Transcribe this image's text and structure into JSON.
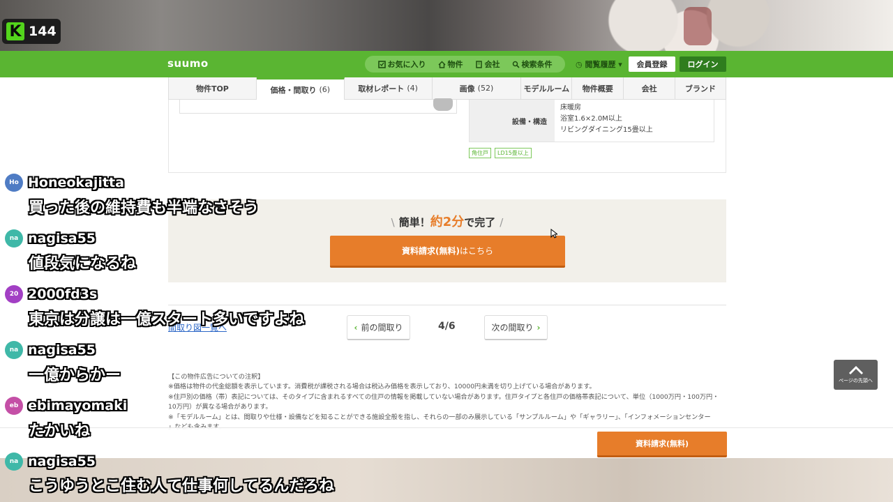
{
  "stream": {
    "badge_count": "144"
  },
  "header": {
    "logo": "suumo",
    "nav": [
      {
        "label": "お気に入り",
        "icon": "bookmark-icon"
      },
      {
        "label": "物件",
        "icon": "house-icon"
      },
      {
        "label": "会社",
        "icon": "building-icon"
      },
      {
        "label": "検索条件",
        "icon": "search-icon"
      }
    ],
    "history": "閲覧履歴",
    "register": "会員登録",
    "login": "ログイン"
  },
  "tabs": [
    {
      "label": "物件TOP",
      "count": ""
    },
    {
      "label": "価格・間取り",
      "count": "(6)"
    },
    {
      "label": "取材レポート",
      "count": "(4)"
    },
    {
      "label": "画像",
      "count": "(52)"
    },
    {
      "label": "モデルルーム",
      "count": ""
    },
    {
      "label": "物件概要",
      "count": ""
    },
    {
      "label": "会社",
      "count": ""
    },
    {
      "label": "ブランド",
      "count": ""
    }
  ],
  "spec": {
    "label": "設備・構造",
    "lines": [
      "床暖房",
      "浴室1.6×2.0M以上",
      "リビングダイニング15畳以上"
    ]
  },
  "tags": [
    "角住戸",
    "LD15畳以上"
  ],
  "cta": {
    "prefix": "簡単！",
    "highlight": "約2分",
    "suffix": "で完了",
    "button_bold": "資料請求(無料)",
    "button_rest": "はこちら"
  },
  "floorplan": {
    "list_link": "間取り図一覧へ",
    "prev": "前の間取り",
    "next": "次の間取り",
    "page": "4/6"
  },
  "notes": {
    "lines": [
      "【この物件広告についての注釈】",
      "※価格は物件の代金総額を表示しています。消費税が課税される場合は税込み価格を表示しており、10000円未満を切り上げている場合があります。",
      "※住戸別の価格（帯）表記については、そのタイプに含まれるすべての住戸の情報を掲載していない場合があります。住戸タイプと各住戸の価格帯表記について、単位（1000万円・100万円・",
      "10万円）が異なる場合があります。",
      "※「モデルルーム」とは、間取りや仕様・設備などを知ることができる施設全般を指し、それらの一部のみ展示している「サンプルルーム」や「ギャラリー」、「インフォメーションセンター",
      "」なども含みます。"
    ]
  },
  "sticky_button": "資料請求(無料)",
  "to_top": "ページの先頭へ",
  "chat": [
    {
      "initials": "Ho",
      "name": "Honeokajitta",
      "message": "買った後の維持費も半端なさそう",
      "color": "#4f7cc4"
    },
    {
      "initials": "na",
      "name": "nagisa55",
      "message": "値段気になるね",
      "color": "#3fb8a8"
    },
    {
      "initials": "20",
      "name": "2000fd3s",
      "message": "東京は分譲は一億スタート多いですよね",
      "color": "#a23fc4"
    },
    {
      "initials": "na",
      "name": "nagisa55",
      "message": "一億からかー",
      "color": "#3fb8a8"
    },
    {
      "initials": "eb",
      "name": "ebimayomaki",
      "message": "たかいね",
      "color": "#c44fa6"
    },
    {
      "initials": "na",
      "name": "nagisa55",
      "message": "こうゆうとこ住む人て仕事何してるんだろね",
      "color": "#3fb8a8"
    }
  ]
}
